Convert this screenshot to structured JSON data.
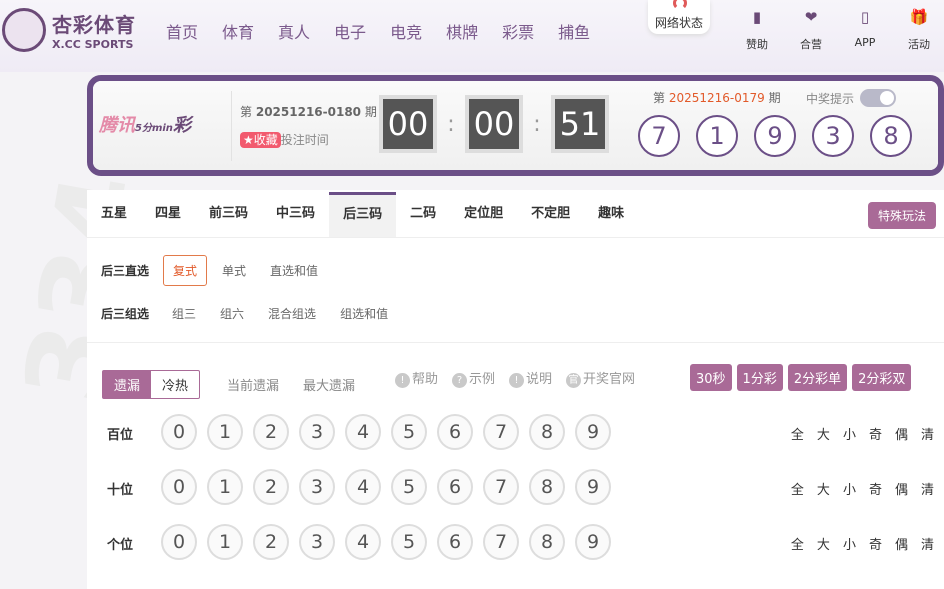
{
  "header": {
    "logo_cn": "杏彩体育",
    "logo_en": "X.CC SPORTS",
    "nav": [
      "首页",
      "体育",
      "真人",
      "电子",
      "电竞",
      "棋牌",
      "彩票",
      "捕鱼"
    ],
    "network_status": "网络状态",
    "tools": [
      {
        "label": "赞助",
        "icon": "bookmark-icon"
      },
      {
        "label": "合营",
        "icon": "handshake-icon"
      },
      {
        "label": "APP",
        "icon": "phone-icon"
      },
      {
        "label": "活动",
        "icon": "gift-icon"
      }
    ]
  },
  "lottery": {
    "brand": "腾讯",
    "brand_sub": "5分min",
    "brand_tail": "彩",
    "issue_prefix": "第",
    "issue": "20251216-0180",
    "issue_suffix": "期",
    "favorite": "★收藏",
    "bet_time": "投注时间",
    "timer": [
      "00",
      "00",
      "51"
    ],
    "prev_issue": "20251216-0179",
    "win_notice": "中奖提示",
    "balls": [
      "7",
      "1",
      "9",
      "3",
      "8"
    ]
  },
  "tabs": [
    "五星",
    "四星",
    "前三码",
    "中三码",
    "后三码",
    "二码",
    "定位胆",
    "不定胆",
    "趣味"
  ],
  "special": "特殊玩法",
  "groups": [
    {
      "label": "后三直选",
      "options": [
        "复式",
        "单式",
        "直选和值"
      ]
    },
    {
      "label": "后三组选",
      "options": [
        "组三",
        "组六",
        "混合组选",
        "组选和值"
      ]
    }
  ],
  "controls": {
    "seg": [
      "遗漏",
      "冷热"
    ],
    "current_miss": "当前遗漏",
    "max_miss": "最大遗漏",
    "helps": [
      "帮助",
      "示例",
      "说明",
      "开奖官网"
    ],
    "periods": [
      "30秒",
      "1分彩",
      "2分彩单",
      "2分彩双"
    ]
  },
  "rows": [
    {
      "label": "百位"
    },
    {
      "label": "十位"
    },
    {
      "label": "个位"
    }
  ],
  "digits": [
    "0",
    "1",
    "2",
    "3",
    "4",
    "5",
    "6",
    "7",
    "8",
    "9"
  ],
  "quick": [
    "全",
    "大",
    "小",
    "奇",
    "偶",
    "清"
  ],
  "colors": {
    "accent": "#6b4f87",
    "button": "#a96a97",
    "highlight": "#e25a2a"
  }
}
